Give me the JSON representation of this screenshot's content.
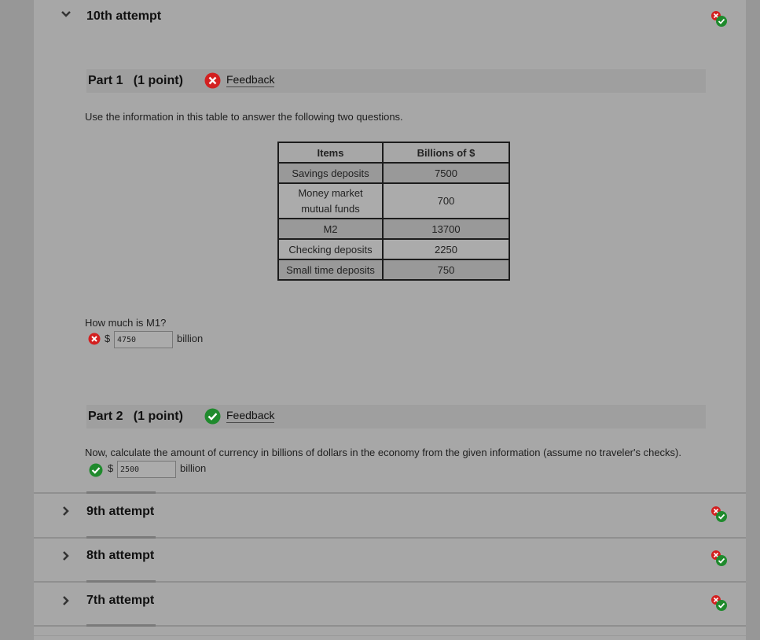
{
  "attempts": {
    "current": {
      "title": "10th attempt",
      "part1": {
        "title": "Part 1   (1 point)",
        "feedback_label": "Feedback",
        "intro": "Use the information in this table to answer the following two questions.",
        "question": "How much is M1?",
        "currency": "$",
        "answer": "4750",
        "unit": "billion",
        "result": "incorrect"
      },
      "part2": {
        "title": "Part 2   (1 point)",
        "feedback_label": "Feedback",
        "question": "Now, calculate the amount of currency in billions of dollars in the economy from the given information (assume no traveler's checks).",
        "currency": "$",
        "answer": "2500",
        "unit": "billion",
        "result": "correct"
      }
    },
    "collapsed": [
      {
        "title": "9th attempt"
      },
      {
        "title": "8th attempt"
      },
      {
        "title": "7th attempt"
      }
    ]
  },
  "table": {
    "headers": [
      "Items",
      "Billions of $"
    ],
    "rows": [
      [
        "Savings deposits",
        "7500"
      ],
      [
        "Money market mutual funds",
        "700"
      ],
      [
        "M2",
        "13700"
      ],
      [
        "Checking deposits",
        "2250"
      ],
      [
        "Small time deposits",
        "750"
      ]
    ]
  },
  "colors": {
    "incorrect": "#d32020",
    "correct": "#1f8a2d"
  }
}
